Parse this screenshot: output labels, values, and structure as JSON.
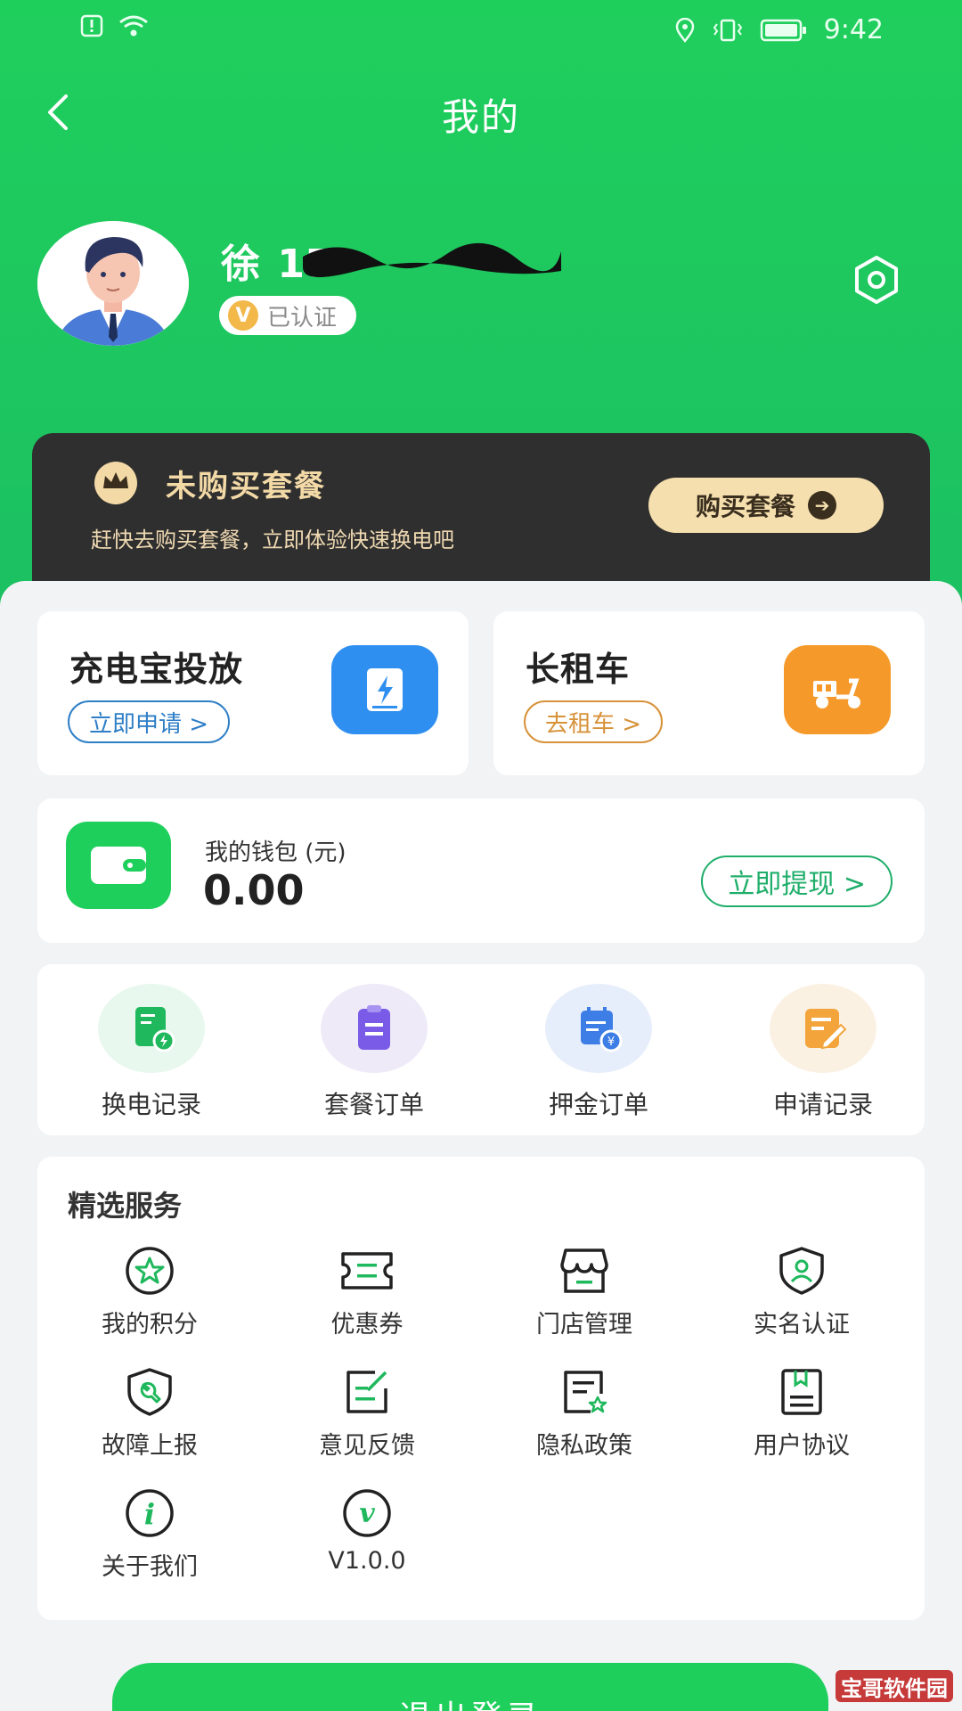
{
  "status_bar": {
    "time": "9:42"
  },
  "header": {
    "title": "我的"
  },
  "profile": {
    "name": "徐 17",
    "verified_label": "已认证",
    "verified_badge_letter": "V"
  },
  "vip_banner": {
    "title": "未购买套餐",
    "subtitle": "赶快去购买套餐，立即体验快速换电吧",
    "button_label": "购买套餐"
  },
  "cards": [
    {
      "title": "充电宝投放",
      "action": "立即申请 >",
      "icon": "power-bank-icon",
      "color": "#2f8ff0"
    },
    {
      "title": "长租车",
      "action": "去租车 >",
      "icon": "scooter-icon",
      "color": "#f59a2a"
    }
  ],
  "wallet": {
    "label": "我的钱包 (元)",
    "value": "0.00",
    "action": "立即提现 >"
  },
  "orders": [
    {
      "label": "换电记录",
      "icon": "battery-swap-record-icon"
    },
    {
      "label": "套餐订单",
      "icon": "package-order-icon"
    },
    {
      "label": "押金订单",
      "icon": "deposit-order-icon"
    },
    {
      "label": "申请记录",
      "icon": "application-record-icon"
    }
  ],
  "services": {
    "title": "精选服务",
    "items": [
      {
        "label": "我的积分",
        "icon": "star-icon"
      },
      {
        "label": "优惠券",
        "icon": "coupon-icon"
      },
      {
        "label": "门店管理",
        "icon": "store-icon"
      },
      {
        "label": "实名认证",
        "icon": "shield-user-icon"
      },
      {
        "label": "故障上报",
        "icon": "wrench-icon"
      },
      {
        "label": "意见反馈",
        "icon": "feedback-icon"
      },
      {
        "label": "隐私政策",
        "icon": "privacy-icon"
      },
      {
        "label": "用户协议",
        "icon": "agreement-icon"
      },
      {
        "label": "关于我们",
        "icon": "info-icon",
        "glyph": "i"
      },
      {
        "label": "V1.0.0",
        "icon": "version-icon",
        "glyph": "v"
      }
    ]
  },
  "logout": {
    "label": "退出登录"
  },
  "watermark": {
    "text": "宝哥软件园"
  },
  "theme": {
    "primary": "#1fcf5c",
    "dark_banner": "#2f2f2f",
    "gold": "#f5dfae"
  }
}
